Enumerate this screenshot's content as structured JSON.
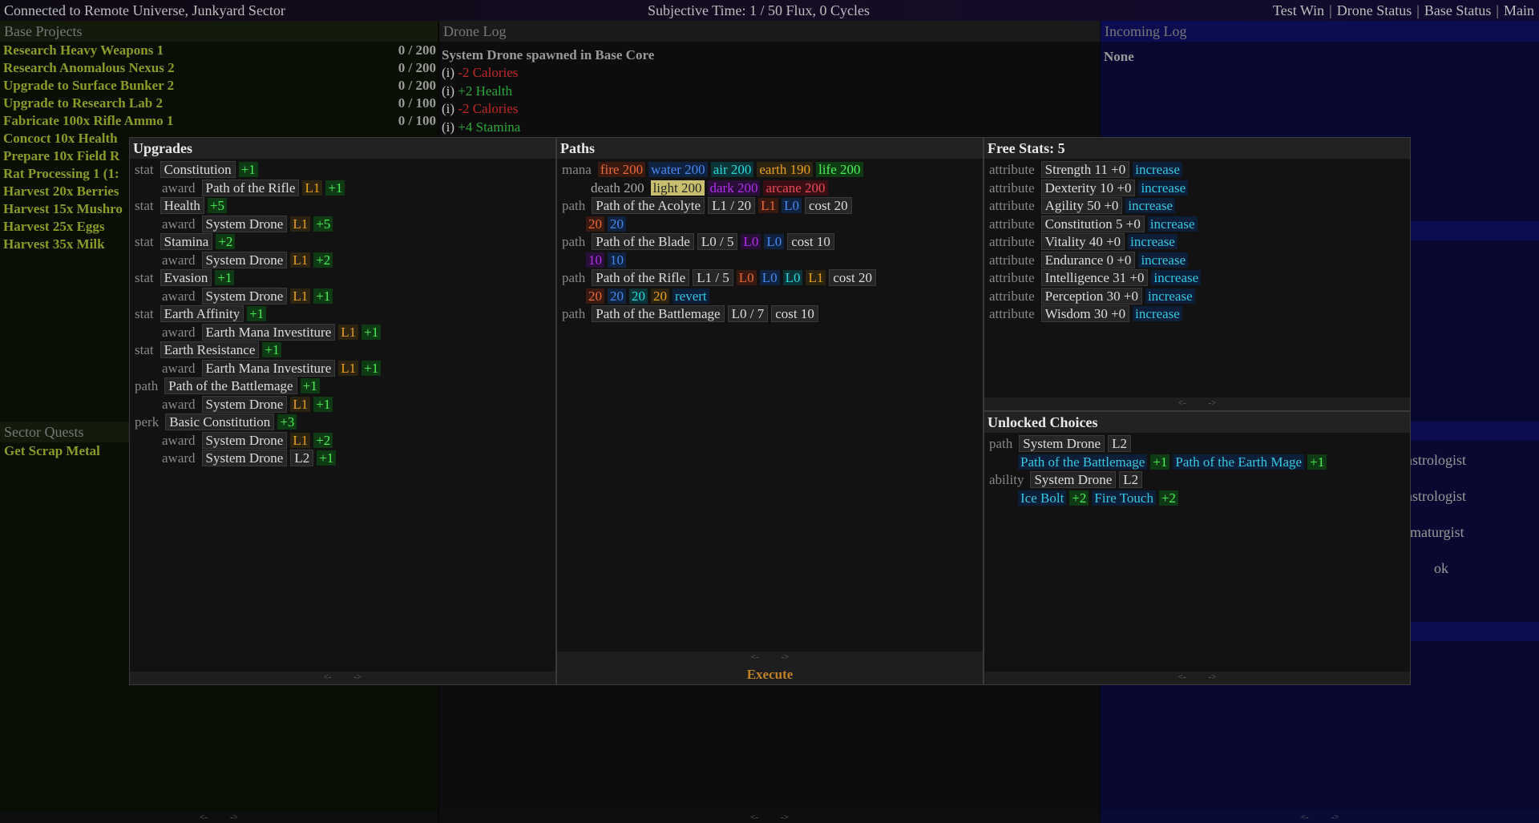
{
  "topbar": {
    "connection": "Connected to Remote Universe, Junkyard Sector",
    "time": "Subjective Time: 1 / 50 Flux,  0 Cycles",
    "nav": [
      "Test Win",
      "Drone Status",
      "Base Status",
      "Main"
    ]
  },
  "colors": {
    "olive": "#8c9a2a",
    "green": "#4ef05a",
    "red": "#c02828",
    "cyan": "#35c8e0",
    "gold": "#c89020"
  },
  "base_projects": {
    "title": "Base Projects",
    "items": [
      {
        "name": "Research Heavy Weapons 1",
        "progress": "0 / 200"
      },
      {
        "name": "Research Anomalous Nexus 2",
        "progress": "0 / 200"
      },
      {
        "name": "Upgrade to Surface Bunker 2",
        "progress": "0 / 200"
      },
      {
        "name": "Upgrade to Research Lab 2",
        "progress": "0 / 100"
      },
      {
        "name": "Fabricate 100x Rifle Ammo 1",
        "progress": "0 / 100"
      },
      {
        "name": "Concoct 10x Health",
        "progress": ""
      },
      {
        "name": "Prepare 10x Field R",
        "progress": ""
      },
      {
        "name": "Rat Processing 1 (1:",
        "progress": ""
      },
      {
        "name": "Harvest 20x Berries",
        "progress": ""
      },
      {
        "name": "Harvest 15x Mushro",
        "progress": ""
      },
      {
        "name": "Harvest 25x Eggs",
        "progress": ""
      },
      {
        "name": "Harvest 35x Milk",
        "progress": ""
      }
    ]
  },
  "sector_quests": {
    "title": "Sector Quests",
    "items": [
      "Get Scrap Metal"
    ]
  },
  "drone_log": {
    "title": "Drone Log",
    "spawn": "System Drone spawned in Base Core",
    "entries": [
      {
        "prefix": "(i)",
        "text": "-2 Calories",
        "tone": "red"
      },
      {
        "prefix": "(i)",
        "text": "+2 Health",
        "tone": "green"
      },
      {
        "prefix": "(i)",
        "text": "-2 Calories",
        "tone": "red"
      },
      {
        "prefix": "(i)",
        "text": "+4 Stamina",
        "tone": "green"
      }
    ]
  },
  "incoming_log": {
    "title": "Incoming Log",
    "text": "None",
    "behind": [
      "nstrologist",
      "nstrologist",
      "rmaturgist",
      "ok"
    ]
  },
  "pager": {
    "prev": "<-",
    "next": "->"
  },
  "upgrades": {
    "title": "Upgrades",
    "rows": [
      {
        "kind": "stat",
        "name": "Constitution",
        "bonus": "+1"
      },
      {
        "kind": "award",
        "name": "Path of the Rifle",
        "level": "L1",
        "bonus": "+1",
        "indent": true
      },
      {
        "kind": "stat",
        "name": "Health",
        "bonus": "+5"
      },
      {
        "kind": "award",
        "name": "System Drone",
        "level": "L1",
        "bonus": "+5",
        "indent": true
      },
      {
        "kind": "stat",
        "name": "Stamina",
        "bonus": "+2"
      },
      {
        "kind": "award",
        "name": "System Drone",
        "level": "L1",
        "bonus": "+2",
        "indent": true
      },
      {
        "kind": "stat",
        "name": "Evasion",
        "bonus": "+1"
      },
      {
        "kind": "award",
        "name": "System Drone",
        "level": "L1",
        "bonus": "+1",
        "indent": true
      },
      {
        "kind": "stat",
        "name": "Earth Affinity",
        "bonus": "+1"
      },
      {
        "kind": "award",
        "name": "Earth Mana Investiture",
        "level": "L1",
        "bonus": "+1",
        "indent": true
      },
      {
        "kind": "stat",
        "name": "Earth Resistance",
        "bonus": "+1"
      },
      {
        "kind": "award",
        "name": "Earth Mana Investiture",
        "level": "L1",
        "bonus": "+1",
        "indent": true
      },
      {
        "kind": "path",
        "name": "Path of the Battlemage",
        "bonus": "+1"
      },
      {
        "kind": "award",
        "name": "System Drone",
        "level": "L1",
        "bonus": "+1",
        "indent": true
      },
      {
        "kind": "perk",
        "name": "Basic Constitution",
        "bonus": "+3"
      },
      {
        "kind": "award",
        "name": "System Drone",
        "level": "L1",
        "bonus": "+2",
        "indent": true
      },
      {
        "kind": "award",
        "name": "System Drone",
        "level": "L2",
        "bonus": "+1",
        "indent": true
      }
    ]
  },
  "paths": {
    "title": "Paths",
    "mana_label": "mana",
    "mana": [
      {
        "text": "fire 200",
        "c": "or"
      },
      {
        "text": "water 200",
        "c": "bl"
      },
      {
        "text": "air 200",
        "c": "tq"
      },
      {
        "text": "earth 190",
        "c": "y"
      },
      {
        "text": "life 200",
        "c": "g"
      }
    ],
    "mana2": [
      {
        "text": "death 200",
        "c": "dk"
      },
      {
        "text": "light 200",
        "c": "ly"
      },
      {
        "text": "dark 200",
        "c": "pu"
      },
      {
        "text": "arcane 200",
        "c": "rd"
      }
    ],
    "rows": [
      {
        "kind": "path",
        "name": "Path of the Acolyte",
        "lvl": "L1 / 20",
        "tags": [
          {
            "t": "L1",
            "c": "or"
          },
          {
            "t": "L0",
            "c": "bl"
          }
        ],
        "cost": "cost 20",
        "req": [
          {
            "t": "20",
            "c": "or"
          },
          {
            "t": "20",
            "c": "bl"
          }
        ]
      },
      {
        "kind": "path",
        "name": "Path of the Blade",
        "lvl": "L0 / 5",
        "tags": [
          {
            "t": "L0",
            "c": "pu"
          },
          {
            "t": "L0",
            "c": "bl"
          }
        ],
        "cost": "cost 10",
        "req": [
          {
            "t": "10",
            "c": "pu"
          },
          {
            "t": "10",
            "c": "bl"
          }
        ]
      },
      {
        "kind": "path",
        "name": "Path of the Rifle",
        "lvl": "L1 / 5",
        "tags": [
          {
            "t": "L0",
            "c": "or"
          },
          {
            "t": "L0",
            "c": "bl"
          },
          {
            "t": "L0",
            "c": "tq"
          },
          {
            "t": "L1",
            "c": "y"
          }
        ],
        "cost": "cost 20",
        "req": [
          {
            "t": "20",
            "c": "or"
          },
          {
            "t": "20",
            "c": "bl"
          },
          {
            "t": "20",
            "c": "tq"
          },
          {
            "t": "20",
            "c": "y"
          }
        ],
        "action": "revert"
      },
      {
        "kind": "path",
        "name": "Path of the Battlemage",
        "lvl": "L0 / 7",
        "tags": [],
        "cost": "cost 10",
        "req": []
      }
    ],
    "execute": "Execute"
  },
  "free_stats": {
    "title": "Free Stats: 5",
    "kind": "attribute",
    "action": "increase",
    "rows": [
      "Strength 11 +0",
      "Dexterity 10 +0",
      "Agility 50 +0",
      "Constitution 5 +0",
      "Vitality 40 +0",
      "Endurance 0 +0",
      "Intelligence 31 +0",
      "Perception 30 +0",
      "Wisdom 30 +0"
    ]
  },
  "unlocked": {
    "title": "Unlocked Choices",
    "groups": [
      {
        "kind": "path",
        "name": "System Drone",
        "level": "L2",
        "choices": [
          {
            "name": "Path of the Battlemage",
            "bonus": "+1"
          },
          {
            "name": "Path of the Earth Mage",
            "bonus": "+1"
          }
        ]
      },
      {
        "kind": "ability",
        "name": "System Drone",
        "level": "L2",
        "choices": [
          {
            "name": "Ice Bolt",
            "bonus": "+2"
          },
          {
            "name": "Fire Touch",
            "bonus": "+2"
          }
        ]
      }
    ]
  }
}
